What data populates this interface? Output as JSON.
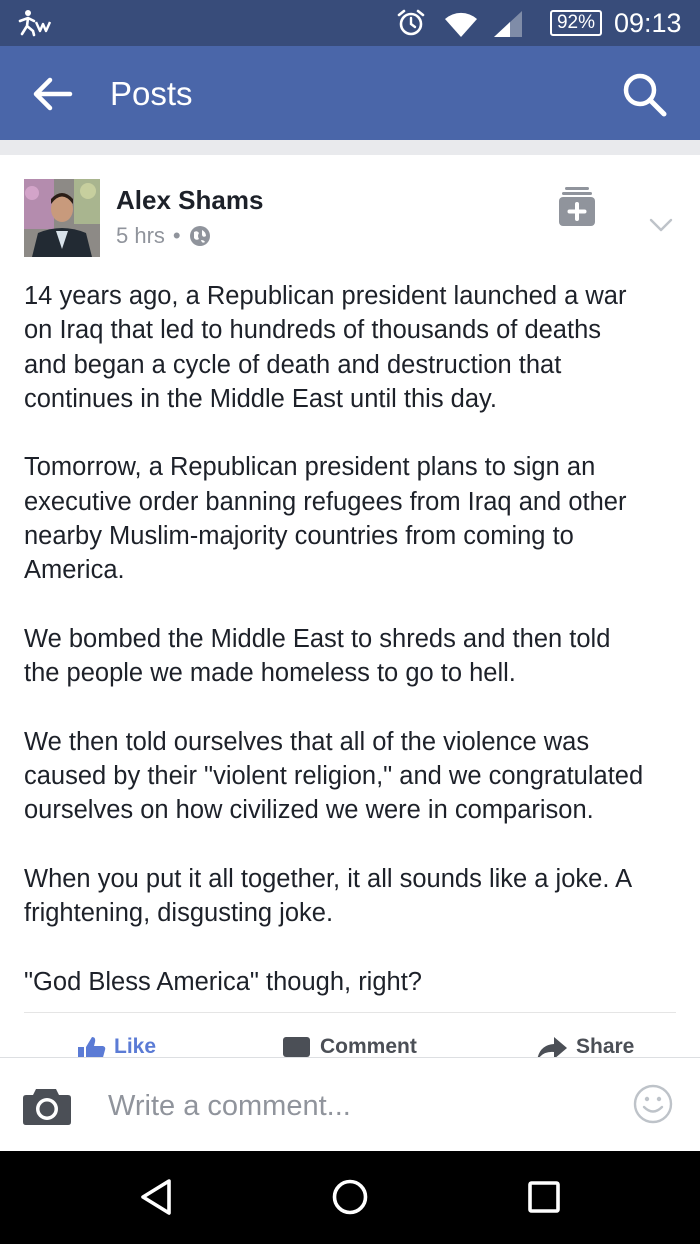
{
  "status_bar": {
    "battery": "92%",
    "time": "09:13",
    "icons": [
      "app-activity-icon",
      "alarm-icon",
      "wifi-icon",
      "signal-icon",
      "battery-icon"
    ]
  },
  "app_bar": {
    "title": "Posts",
    "icons": [
      "back-arrow-icon",
      "search-icon"
    ],
    "background": "#4a66a9"
  },
  "post": {
    "author": "Alex Shams",
    "time_ago": "5 hrs",
    "separator": "•",
    "icons": [
      "globe-icon",
      "save-icon",
      "chevron-down-icon"
    ],
    "paragraphs": [
      [
        "14 years ago, a Republican president launched a war",
        "on Iraq that led to hundreds of thousands of deaths",
        "and began a cycle of death and destruction that",
        "continues in the Middle East until this day."
      ],
      [
        "Tomorrow, a Republican president plans to sign an",
        "executive order banning refugees from Iraq and other",
        "nearby Muslim-majority countries from coming to",
        "America."
      ],
      [
        "We bombed the Middle East to shreds and then told",
        "the people we made homeless to go to hell."
      ],
      [
        "We then told ourselves that all of the violence was",
        "caused by their \"violent religion,\" and we congratulated",
        "ourselves on how civilized we were in comparison."
      ],
      [
        "When you put it all together, it all sounds like a joke. A",
        "frightening, disgusting joke."
      ],
      [
        "\"God Bless America\" though, right?"
      ]
    ],
    "actions": {
      "like": "Like",
      "comment": "Comment",
      "share": "Share"
    }
  },
  "comment_bar": {
    "placeholder": "Write a comment...",
    "icons": [
      "camera-icon",
      "emoji-icon"
    ]
  },
  "nav_bar": {
    "icons": [
      "back-triangle-icon",
      "home-circle-icon",
      "recents-square-icon"
    ]
  },
  "colors": {
    "status_bar": "#384c7a",
    "accent": "#4a66a9",
    "like_blue": "#5b7bd5",
    "text": "#1d2129",
    "muted": "#90949c"
  }
}
